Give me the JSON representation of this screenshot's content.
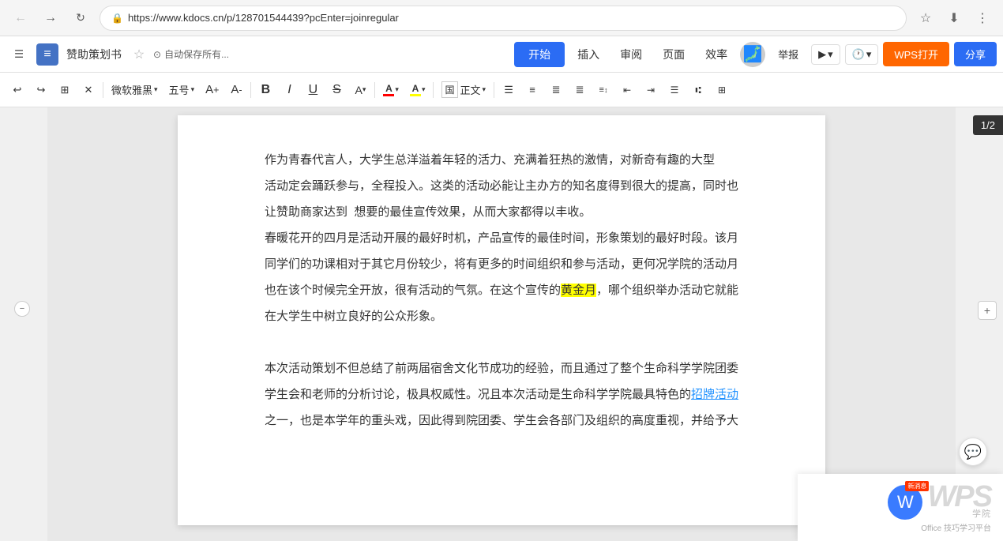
{
  "browser": {
    "url": "https://www.kdocs.cn/p/128701544439?pcEnter=joinregular",
    "back_disabled": true,
    "forward_disabled": false
  },
  "app": {
    "doc_title": "赞助策划书",
    "autosave": "自动保存所有...",
    "tabs": {
      "start": "开始",
      "insert": "插入",
      "review": "审阅",
      "page": "页面",
      "efficiency": "效率"
    },
    "report": "举报",
    "wps_open": "WPS打开",
    "share": "分享"
  },
  "toolbar": {
    "font_family": "微软雅黑",
    "font_size": "五号",
    "bold": "B",
    "italic": "I",
    "underline": "U",
    "strikethrough": "S",
    "font_color_label": "A",
    "font_color": "#ff0000",
    "highlight_color": "#ffff00",
    "align_justify": "正文",
    "page_indicator": "1/2"
  },
  "content": {
    "para1": "作为青春代言人，大学生总洋溢着年轻的活力、充满着狂热的激情，对新奇有趣的大型",
    "para2": "活动定会踊跃参与，全程投入。这类的活动必能让主办方的知名度得到很大的提高，同时也",
    "para3": "让赞助商家达到  想要的最佳宣传效果，从而大家都得以丰收。",
    "para4": "春暖花开的四月是活动开展的最好时机，产品宣传的最佳时间，形象策划的最好时段。该月",
    "para5": "同学们的功课相对于其它月份较少，将有更多的时间组织和参与活动，更何况学院的活动月",
    "para6": "也在该个时候完全开放，很有活动的气氛。在这个宣传的黄金月，哪个组织举办活动它就能",
    "para7": "在大学生中树立良好的公众形象。",
    "para8": "",
    "para9": "本次活动策划不但总结了前两届宿舍文化节成功的经验，而且通过了整个生命科学学院团委",
    "para10": "学生会和老师的分析讨论，极具权威性。况且本次活动是生命科学学院最具特色的招牌活动",
    "para11": "之一，也是本学年的重头戏，因此得到院团委、学生会各部门及组织的高度重视，并给予大"
  },
  "wps_promo": {
    "title": "WPS 学院",
    "subtitle": "Office 技巧学习平台",
    "badge": "新消息"
  }
}
